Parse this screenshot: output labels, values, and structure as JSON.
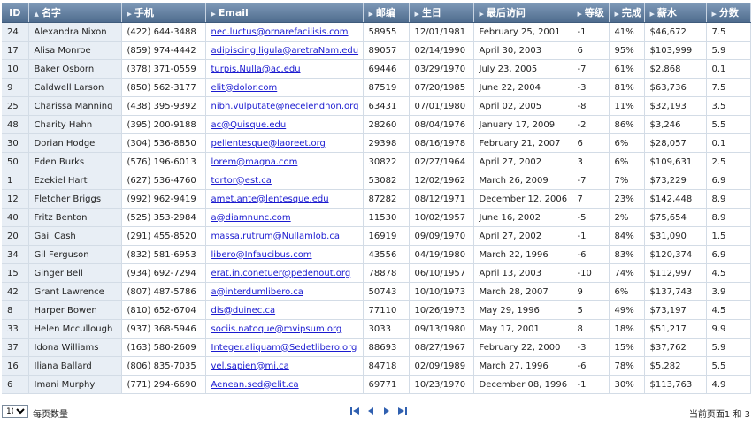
{
  "table": {
    "columns": [
      {
        "label": "ID",
        "icon": "",
        "sorted": false
      },
      {
        "label": "名字",
        "icon": "sort-asc-icon",
        "sorted": true
      },
      {
        "label": "手机",
        "icon": "sort-icon",
        "sorted": false
      },
      {
        "label": "Email",
        "icon": "sort-icon",
        "sorted": false
      },
      {
        "label": "邮编",
        "icon": "sort-icon",
        "sorted": false
      },
      {
        "label": "生日",
        "icon": "sort-icon",
        "sorted": false
      },
      {
        "label": "最后访问",
        "icon": "sort-icon",
        "sorted": false
      },
      {
        "label": "等级",
        "icon": "sort-icon",
        "sorted": false
      },
      {
        "label": "完成",
        "icon": "sort-icon",
        "sorted": false
      },
      {
        "label": "薪水",
        "icon": "sort-icon",
        "sorted": false
      },
      {
        "label": "分数",
        "icon": "sort-icon",
        "sorted": false
      }
    ],
    "rows": [
      [
        "24",
        "Alexandra Nixon",
        "(422) 644-3488",
        "nec.luctus@ornarefacilisis.com",
        "58955",
        "12/01/1981",
        "February 25, 2001",
        "-1",
        "41%",
        "$46,672",
        "7.5"
      ],
      [
        "17",
        "Alisa Monroe",
        "(859) 974-4442",
        "adipiscing.ligula@aretraNam.edu",
        "89057",
        "02/14/1990",
        "April 30, 2003",
        "6",
        "95%",
        "$103,999",
        "5.9"
      ],
      [
        "10",
        "Baker Osborn",
        "(378) 371-0559",
        "turpis.Nulla@ac.edu",
        "69446",
        "03/29/1970",
        "July 23, 2005",
        "-7",
        "61%",
        "$2,868",
        "0.1"
      ],
      [
        "9",
        "Caldwell Larson",
        "(850) 562-3177",
        "elit@dolor.com",
        "87519",
        "07/20/1985",
        "June 22, 2004",
        "-3",
        "81%",
        "$63,736",
        "7.5"
      ],
      [
        "25",
        "Charissa Manning",
        "(438) 395-9392",
        "nibh.vulputate@necelendnon.org",
        "63431",
        "07/01/1980",
        "April 02, 2005",
        "-8",
        "11%",
        "$32,193",
        "3.5"
      ],
      [
        "48",
        "Charity Hahn",
        "(395) 200-9188",
        "ac@Quisque.edu",
        "28260",
        "08/04/1976",
        "January 17, 2009",
        "-2",
        "86%",
        "$3,246",
        "5.5"
      ],
      [
        "30",
        "Dorian Hodge",
        "(304) 536-8850",
        "pellentesque@laoreet.org",
        "29398",
        "08/16/1978",
        "February 21, 2007",
        "6",
        "6%",
        "$28,057",
        "0.1"
      ],
      [
        "50",
        "Eden Burks",
        "(576) 196-6013",
        "lorem@magna.com",
        "30822",
        "02/27/1964",
        "April 27, 2002",
        "3",
        "6%",
        "$109,631",
        "2.5"
      ],
      [
        "1",
        "Ezekiel Hart",
        "(627) 536-4760",
        "tortor@est.ca",
        "53082",
        "12/02/1962",
        "March 26, 2009",
        "-7",
        "7%",
        "$73,229",
        "6.9"
      ],
      [
        "12",
        "Fletcher Briggs",
        "(992) 962-9419",
        "amet.ante@lentesque.edu",
        "87282",
        "08/12/1971",
        "December 12, 2006",
        "7",
        "23%",
        "$142,448",
        "8.9"
      ],
      [
        "40",
        "Fritz Benton",
        "(525) 353-2984",
        "a@diamnunc.com",
        "11530",
        "10/02/1957",
        "June 16, 2002",
        "-5",
        "2%",
        "$75,654",
        "8.9"
      ],
      [
        "20",
        "Gail Cash",
        "(291) 455-8520",
        "massa.rutrum@Nullamlob.ca",
        "16919",
        "09/09/1970",
        "April 27, 2002",
        "-1",
        "84%",
        "$31,090",
        "1.5"
      ],
      [
        "34",
        "Gil Ferguson",
        "(832) 581-6953",
        "libero@Infaucibus.com",
        "43556",
        "04/19/1980",
        "March 22, 1996",
        "-6",
        "83%",
        "$120,374",
        "6.9"
      ],
      [
        "15",
        "Ginger Bell",
        "(934) 692-7294",
        "erat.in.conetuer@pedenout.org",
        "78878",
        "06/10/1957",
        "April 13, 2003",
        "-10",
        "74%",
        "$112,997",
        "4.5"
      ],
      [
        "42",
        "Grant Lawrence",
        "(807) 487-5786",
        "a@interdumlibero.ca",
        "50743",
        "10/10/1973",
        "March 28, 2007",
        "9",
        "6%",
        "$137,743",
        "3.9"
      ],
      [
        "8",
        "Harper Bowen",
        "(810) 652-6704",
        "dis@duinec.ca",
        "77110",
        "10/26/1973",
        "May 29, 1996",
        "5",
        "49%",
        "$73,197",
        "4.5"
      ],
      [
        "33",
        "Helen Mccullough",
        "(937) 368-5946",
        "sociis.natoque@mvipsum.org",
        "3033",
        "09/13/1980",
        "May 17, 2001",
        "8",
        "18%",
        "$51,217",
        "9.9"
      ],
      [
        "37",
        "Idona Williams",
        "(163) 580-2609",
        "Integer.aliquam@Sedetlibero.org",
        "88693",
        "08/27/1967",
        "February 22, 2000",
        "-3",
        "15%",
        "$37,762",
        "5.9"
      ],
      [
        "16",
        "Iliana Ballard",
        "(806) 835-7035",
        "vel.sapien@mi.ca",
        "84718",
        "02/09/1989",
        "March 27, 1996",
        "-6",
        "78%",
        "$5,282",
        "5.5"
      ],
      [
        "6",
        "Imani Murphy",
        "(771) 294-6690",
        "Aenean.sed@elit.ca",
        "69771",
        "10/23/1970",
        "December 08, 1996",
        "-1",
        "30%",
        "$113,763",
        "4.9"
      ]
    ]
  },
  "footer": {
    "page_size": "10",
    "page_size_options": [
      "10"
    ],
    "page_size_label": "每页数量",
    "page_info": "当前页面1 和 3",
    "pager_icons": [
      "first-page-icon",
      "prev-page-icon",
      "next-page-icon",
      "last-page-icon"
    ]
  },
  "colors": {
    "header_top": "#7f9ab8",
    "header_bottom": "#4f6c8e",
    "id_name_column_bg": "#e8eef5",
    "link": "#1a1ad0",
    "pager_icon": "#3060b0"
  }
}
